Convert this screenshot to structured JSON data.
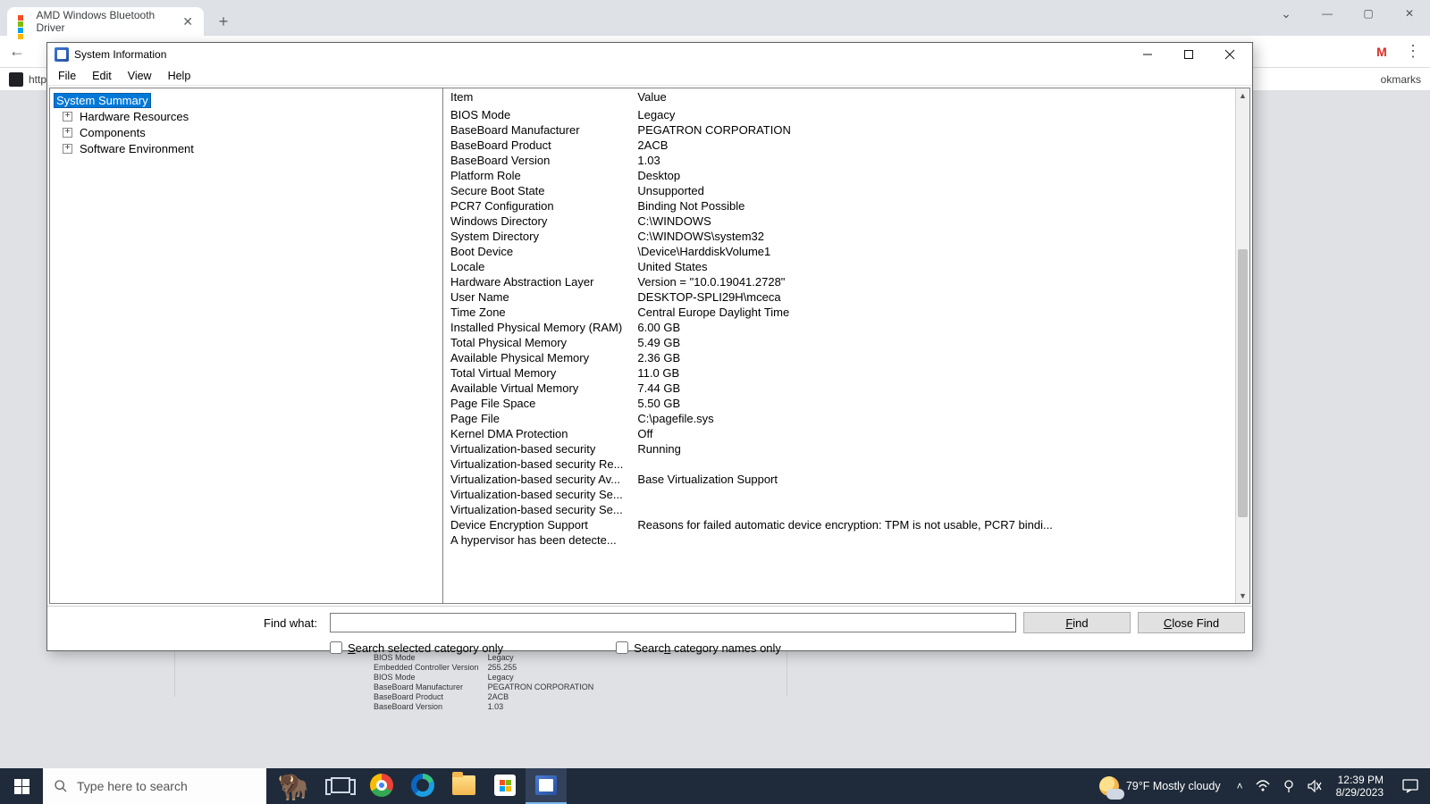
{
  "browser": {
    "tab_title": "AMD Windows Bluetooth Driver",
    "bookmarks_left": "http",
    "bookmarks_right": "okmarks",
    "avatar_letter": "M"
  },
  "sysinfo": {
    "title": "System Information",
    "menu": {
      "file": "File",
      "edit": "Edit",
      "view": "View",
      "help": "Help"
    },
    "tree": {
      "summary": "System Summary",
      "hardware": "Hardware Resources",
      "components": "Components",
      "software": "Software Environment"
    },
    "cols": {
      "item": "Item",
      "value": "Value"
    },
    "rows": [
      {
        "item": "BIOS Mode",
        "value": "Legacy"
      },
      {
        "item": "BaseBoard Manufacturer",
        "value": "PEGATRON CORPORATION"
      },
      {
        "item": "BaseBoard Product",
        "value": "2ACB"
      },
      {
        "item": "BaseBoard Version",
        "value": "1.03"
      },
      {
        "item": "Platform Role",
        "value": "Desktop"
      },
      {
        "item": "Secure Boot State",
        "value": "Unsupported"
      },
      {
        "item": "PCR7 Configuration",
        "value": "Binding Not Possible"
      },
      {
        "item": "Windows Directory",
        "value": "C:\\WINDOWS"
      },
      {
        "item": "System Directory",
        "value": "C:\\WINDOWS\\system32"
      },
      {
        "item": "Boot Device",
        "value": "\\Device\\HarddiskVolume1"
      },
      {
        "item": "Locale",
        "value": "United States"
      },
      {
        "item": "Hardware Abstraction Layer",
        "value": "Version = \"10.0.19041.2728\""
      },
      {
        "item": "User Name",
        "value": "DESKTOP-SPLI29H\\mceca"
      },
      {
        "item": "Time Zone",
        "value": "Central Europe Daylight Time"
      },
      {
        "item": "Installed Physical Memory (RAM)",
        "value": "6.00 GB"
      },
      {
        "item": "Total Physical Memory",
        "value": "5.49 GB"
      },
      {
        "item": "Available Physical Memory",
        "value": "2.36 GB"
      },
      {
        "item": "Total Virtual Memory",
        "value": "11.0 GB"
      },
      {
        "item": "Available Virtual Memory",
        "value": "7.44 GB"
      },
      {
        "item": "Page File Space",
        "value": "5.50 GB"
      },
      {
        "item": "Page File",
        "value": "C:\\pagefile.sys"
      },
      {
        "item": "Kernel DMA Protection",
        "value": "Off"
      },
      {
        "item": "Virtualization-based security",
        "value": "Running"
      },
      {
        "item": "Virtualization-based security Re...",
        "value": ""
      },
      {
        "item": "Virtualization-based security Av...",
        "value": "Base Virtualization Support"
      },
      {
        "item": "Virtualization-based security Se...",
        "value": ""
      },
      {
        "item": "Virtualization-based security Se...",
        "value": ""
      },
      {
        "item": "Device Encryption Support",
        "value": "Reasons for failed automatic device encryption: TPM is not usable, PCR7 bindi..."
      },
      {
        "item": "A hypervisor has been detecte...",
        "value": ""
      }
    ],
    "find": {
      "label": "Find what:",
      "find_btn": "Find",
      "close_btn": "Close Find",
      "chk_selected": "Search selected category only",
      "chk_names": "Search category names only"
    }
  },
  "bg_thumb": [
    {
      "a": "BIOS Mode",
      "b": "Legacy"
    },
    {
      "a": "Embedded Controller Version",
      "b": "255.255"
    },
    {
      "a": "BIOS Mode",
      "b": "Legacy"
    },
    {
      "a": "BaseBoard Manufacturer",
      "b": "PEGATRON CORPORATION"
    },
    {
      "a": "BaseBoard Product",
      "b": "2ACB"
    },
    {
      "a": "BaseBoard Version",
      "b": "1.03"
    }
  ],
  "taskbar": {
    "search_placeholder": "Type here to search",
    "weather": "79°F  Mostly cloudy",
    "time": "12:39 PM",
    "date": "8/29/2023"
  }
}
